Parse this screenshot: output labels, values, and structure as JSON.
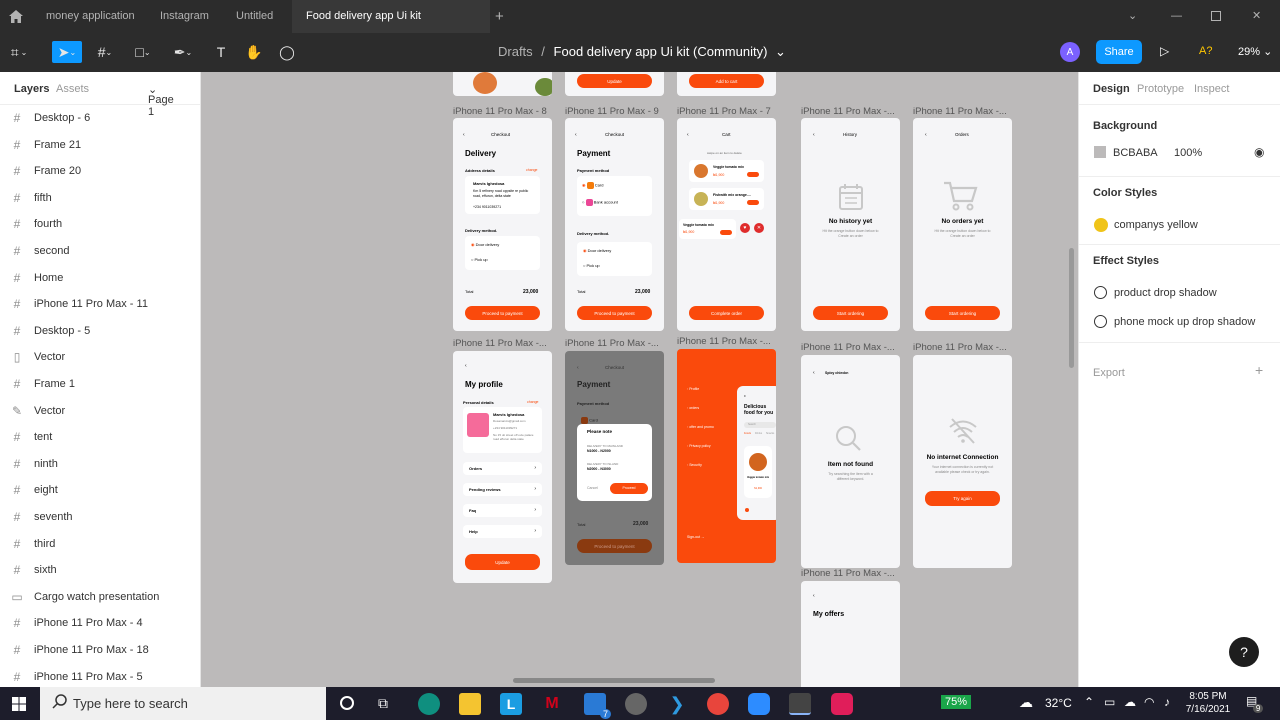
{
  "tabs": [
    {
      "label": "money application"
    },
    {
      "label": "Instagram"
    },
    {
      "label": "Untitled"
    },
    {
      "label": "Food delivery app Ui kit (Community)"
    }
  ],
  "header": {
    "breadcrumb_parent": "Drafts",
    "breadcrumb_sep": "/",
    "file_title": "Food delivery app Ui kit (Community)",
    "avatar_initial": "A",
    "share_label": "Share",
    "zoom": "29%"
  },
  "left_panel": {
    "tab_layers": "Layers",
    "tab_assets": "Assets",
    "page": "Page 1",
    "layers": [
      {
        "name": "Desktop - 6",
        "icon": "#"
      },
      {
        "name": "Frame 21",
        "icon": "#"
      },
      {
        "name": "Frame 20",
        "icon": "#"
      },
      {
        "name": "fifth",
        "icon": "#"
      },
      {
        "name": "fourth",
        "icon": "#"
      },
      {
        "name": "second",
        "icon": "#"
      },
      {
        "name": "Home",
        "icon": "#"
      },
      {
        "name": "iPhone 11 Pro Max - 11",
        "icon": "#"
      },
      {
        "name": "Desktop - 5",
        "icon": "#"
      },
      {
        "name": "Vector",
        "icon": "▯"
      },
      {
        "name": "Frame 1",
        "icon": "#"
      },
      {
        "name": "Vector",
        "icon": "✎"
      },
      {
        "name": "tent",
        "icon": "#"
      },
      {
        "name": "ninth",
        "icon": "#"
      },
      {
        "name": "eight",
        "icon": "#"
      },
      {
        "name": "seventh",
        "icon": "#"
      },
      {
        "name": "third",
        "icon": "#"
      },
      {
        "name": "sixth",
        "icon": "#"
      },
      {
        "name": "Cargo watch presentation",
        "icon": "▭"
      },
      {
        "name": "iPhone 11 Pro Max - 4",
        "icon": "#"
      },
      {
        "name": "iPhone 11 Pro Max - 18",
        "icon": "#"
      },
      {
        "name": "iPhone 11 Pro Max - 5",
        "icon": "#"
      }
    ]
  },
  "right_panel": {
    "tab_design": "Design",
    "tab_prototype": "Prototype",
    "tab_inspect": "Inspect",
    "background_title": "Background",
    "bg_hex": "BCBABA",
    "bg_opacity": "100%",
    "color_styles_title": "Color Styles",
    "color_style": "companys yellow",
    "effect_styles_title": "Effect Styles",
    "effect_1": "product drop shadow",
    "effect_2": "phone mock up drop shadow",
    "export_title": "Export"
  },
  "canvas": {
    "labels": {
      "l8": "iPhone 11 Pro Max - 8",
      "l9": "iPhone 11 Pro Max - 9",
      "l7": "iPhone 11 Pro Max - 7",
      "la": "iPhone 11 Pro Max -...",
      "lb": "iPhone 11 Pro Max -...",
      "lc": "iPhone 11 Pro Max -...",
      "ld": "iPhone 11 Pro Max -...",
      "le": "iPhone 11 Pro Max -...",
      "lf": "iPhone 11 Pro Max -...",
      "lg": "iPhone 11 Pro Max -...",
      "lh": "iPhone 11 Pro Max -..."
    },
    "top_btn1": "Update",
    "top_btn2": "Add to cart",
    "delivery": {
      "nav": "Checkout",
      "title": "Delivery",
      "address_label": "Address details",
      "change": "change",
      "name": "Marvis Ighedosa",
      "addr": "Km 5 refinery road oppsite re public road, effurun, delta state",
      "phone": "+234 9011039271",
      "method": "Delivery method.",
      "opt1": "Door delivery",
      "opt2": "Pick up",
      "total_label": "Total",
      "total": "23,000",
      "btn": "Proceed to payment"
    },
    "payment": {
      "nav": "Checkout",
      "title": "Payment",
      "method": "Payment method",
      "card": "Card",
      "bank": "Bank account",
      "dmethod": "Delivery method.",
      "opt1": "Door delivery",
      "opt2": "Pick up",
      "total_label": "Total",
      "total": "23,000",
      "btn": "Proceed to payment"
    },
    "cart": {
      "nav": "Cart",
      "swipe": "swipe on an item to delete",
      "item": "Veggie tomato mix",
      "price": "₦1,900",
      "item2": "Fishwith mix orange....",
      "price2": "₦1,900",
      "item3": "Veggie tomato mix",
      "price3": "₦1,900",
      "btn": "Complete order"
    },
    "history": {
      "nav": "History",
      "title": "No history yet",
      "desc": "Hit the orange button down below to Create an order",
      "btn": "Start ordering"
    },
    "orders": {
      "nav": "Orders",
      "title": "No orders yet",
      "desc": "Hit the orange button down below to Create an order",
      "btn": "Start ordering"
    },
    "profile": {
      "title": "My profile",
      "personal": "Personal details",
      "change": "change",
      "name": "Marvis Ighedosa",
      "email": "Dosamarvis@gmail.com",
      "phone": "+234 9011039271",
      "addr": "No 15 uti street off ovie palace road effurun delta state",
      "rows": [
        "Orders",
        "Pending reviews",
        "Faq",
        "Help"
      ],
      "btn": "Update"
    },
    "payment_modal": {
      "nav": "Checkout",
      "title": "Payment",
      "method": "Payment method",
      "card": "Card",
      "modal_title": "Please note",
      "l1": "DELIVERY TO MAINLAND",
      "v1": "N1000 - N2000",
      "l2": "DELIVERY TO ISLAND",
      "v2": "N2000 - N3000",
      "cancel": "Cancel",
      "proceed": "Proceed",
      "total_label": "Total",
      "total": "23,000",
      "btn": "Proceed to payment"
    },
    "menu": {
      "items": [
        "Profile",
        "orders",
        "offer and promo",
        "Privacy policy",
        "Security"
      ],
      "signout": "Sign-out →",
      "tagline": "Delicious food for you",
      "search": "Search",
      "tabs": [
        "Foods",
        "Drinks",
        "Snacks"
      ],
      "dish": "Veggie tomato mix",
      "dish_price": "N1,900"
    },
    "notfound": {
      "search": "Spicy chieckn",
      "title": "Item not found",
      "desc": "Try searching the item with a different keyword."
    },
    "noconn": {
      "title": "No internet Connection",
      "desc": "Your internet connection is currently not available please check or try again.",
      "btn": "Try again"
    },
    "offers": {
      "title": "My offers"
    }
  },
  "taskbar": {
    "search_placeholder": "Type here to search",
    "battery": "75%",
    "temp": "32°C",
    "time": "8:05 PM",
    "date": "7/16/2021",
    "mail_badge": "7",
    "notif_badge": "9"
  },
  "help": "?"
}
